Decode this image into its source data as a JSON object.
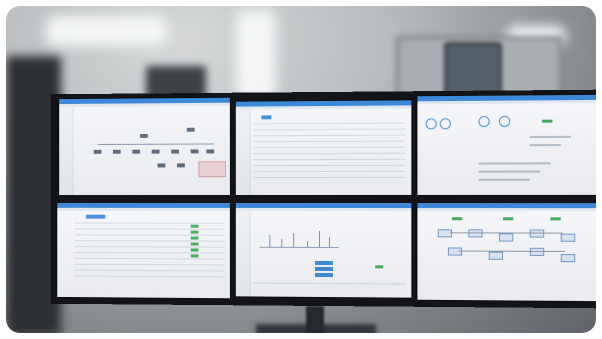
{
  "scene": {
    "description_visible_text": "",
    "screens": [
      {
        "id": "top-left",
        "content": "hierarchy-tree"
      },
      {
        "id": "top-center",
        "content": "table-list"
      },
      {
        "id": "top-right",
        "content": "status-dashboard"
      },
      {
        "id": "bottom-left",
        "content": "data-table"
      },
      {
        "id": "bottom-center",
        "content": "line-chart"
      },
      {
        "id": "bottom-right",
        "content": "flow-diagram"
      }
    ],
    "colors": {
      "title_bar": "#2d7fd6",
      "status_green": "#3cb15a",
      "alert_pink": "#f1d9dc",
      "bezel": "#121417"
    }
  }
}
